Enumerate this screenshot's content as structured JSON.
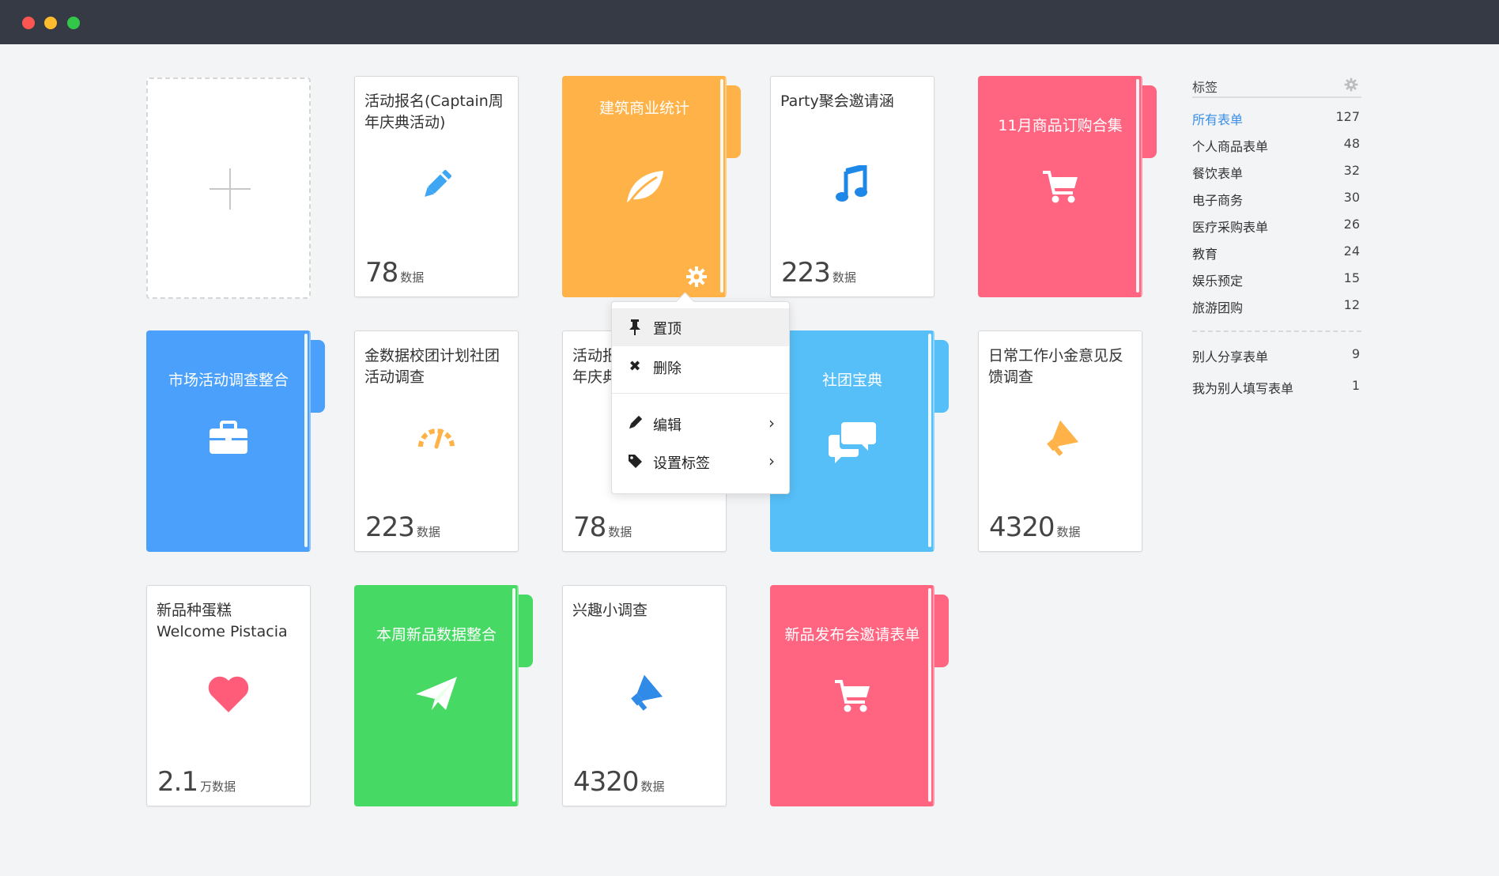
{
  "window": {
    "traffic_lights": [
      "close",
      "minimize",
      "zoom"
    ]
  },
  "cards": {
    "c1": {
      "title": "活动报名(Captain周年庆典活动)",
      "count": "78",
      "unit": "数据",
      "icon": "pencil-icon"
    },
    "c2": {
      "title": "建筑商业统计",
      "icon": "leaf-icon",
      "color": "#ffb247"
    },
    "c3": {
      "title": "Party聚会邀请涵",
      "count": "223",
      "unit": "数据",
      "icon": "music-note-icon"
    },
    "c4": {
      "title": "11月商品订购合集",
      "icon": "shopping-cart-icon",
      "color": "#ff6480"
    },
    "c5": {
      "title": "市场活动调查整合",
      "icon": "briefcase-icon",
      "color": "#4aa0fa"
    },
    "c6": {
      "title": "金数据校团计划社团活动调查",
      "count": "223",
      "unit": "数据",
      "icon": "speedometer-icon"
    },
    "c7": {
      "title": "活动报名(Captain周年庆典活动)",
      "title_visible": "活动报\n年庆典",
      "count": "78",
      "unit": "数据"
    },
    "c8": {
      "title": "社团宝典",
      "icon": "chat-bubbles-icon",
      "color": "#56bff7"
    },
    "c9": {
      "title": "日常工作小金意见反馈调查",
      "count": "4320",
      "unit": "数据",
      "icon": "megaphone-icon"
    },
    "c10": {
      "title": "新品种蛋糕 Welcome Pistacia",
      "count": "2.1",
      "unit": "万数据",
      "icon": "heart-icon"
    },
    "c11": {
      "title": "本周新品数据整合",
      "icon": "paper-plane-icon",
      "color": "#46d964"
    },
    "c12": {
      "title": "兴趣小调查",
      "count": "4320",
      "unit": "数据",
      "icon": "megaphone-icon"
    },
    "c13": {
      "title": "新品发布会邀请表单",
      "icon": "shopping-cart-icon",
      "color": "#ff6480"
    }
  },
  "context_menu": {
    "items": [
      {
        "label": "置顶",
        "icon": "pin-icon"
      },
      {
        "label": "删除",
        "icon": "close-icon"
      },
      {
        "label": "编辑",
        "icon": "pencil-icon",
        "submenu": true
      },
      {
        "label": "设置标签",
        "icon": "tag-icon",
        "submenu": true
      }
    ]
  },
  "sidebar": {
    "header": "标签",
    "tags": [
      {
        "label": "所有表单",
        "count": "127",
        "active": true
      },
      {
        "label": "个人商品表单",
        "count": "48"
      },
      {
        "label": "餐饮表单",
        "count": "32"
      },
      {
        "label": "电子商务",
        "count": "30"
      },
      {
        "label": "医疗采购表单",
        "count": "26"
      },
      {
        "label": "教育",
        "count": "24"
      },
      {
        "label": "娱乐预定",
        "count": "15"
      },
      {
        "label": "旅游团购",
        "count": "12"
      }
    ],
    "shared": [
      {
        "label": "别人分享表单",
        "count": "9"
      },
      {
        "label": "我为别人填写表单",
        "count": "1"
      }
    ]
  },
  "colors": {
    "accent": "#3a8ee6",
    "titlebar": "#363a44"
  }
}
